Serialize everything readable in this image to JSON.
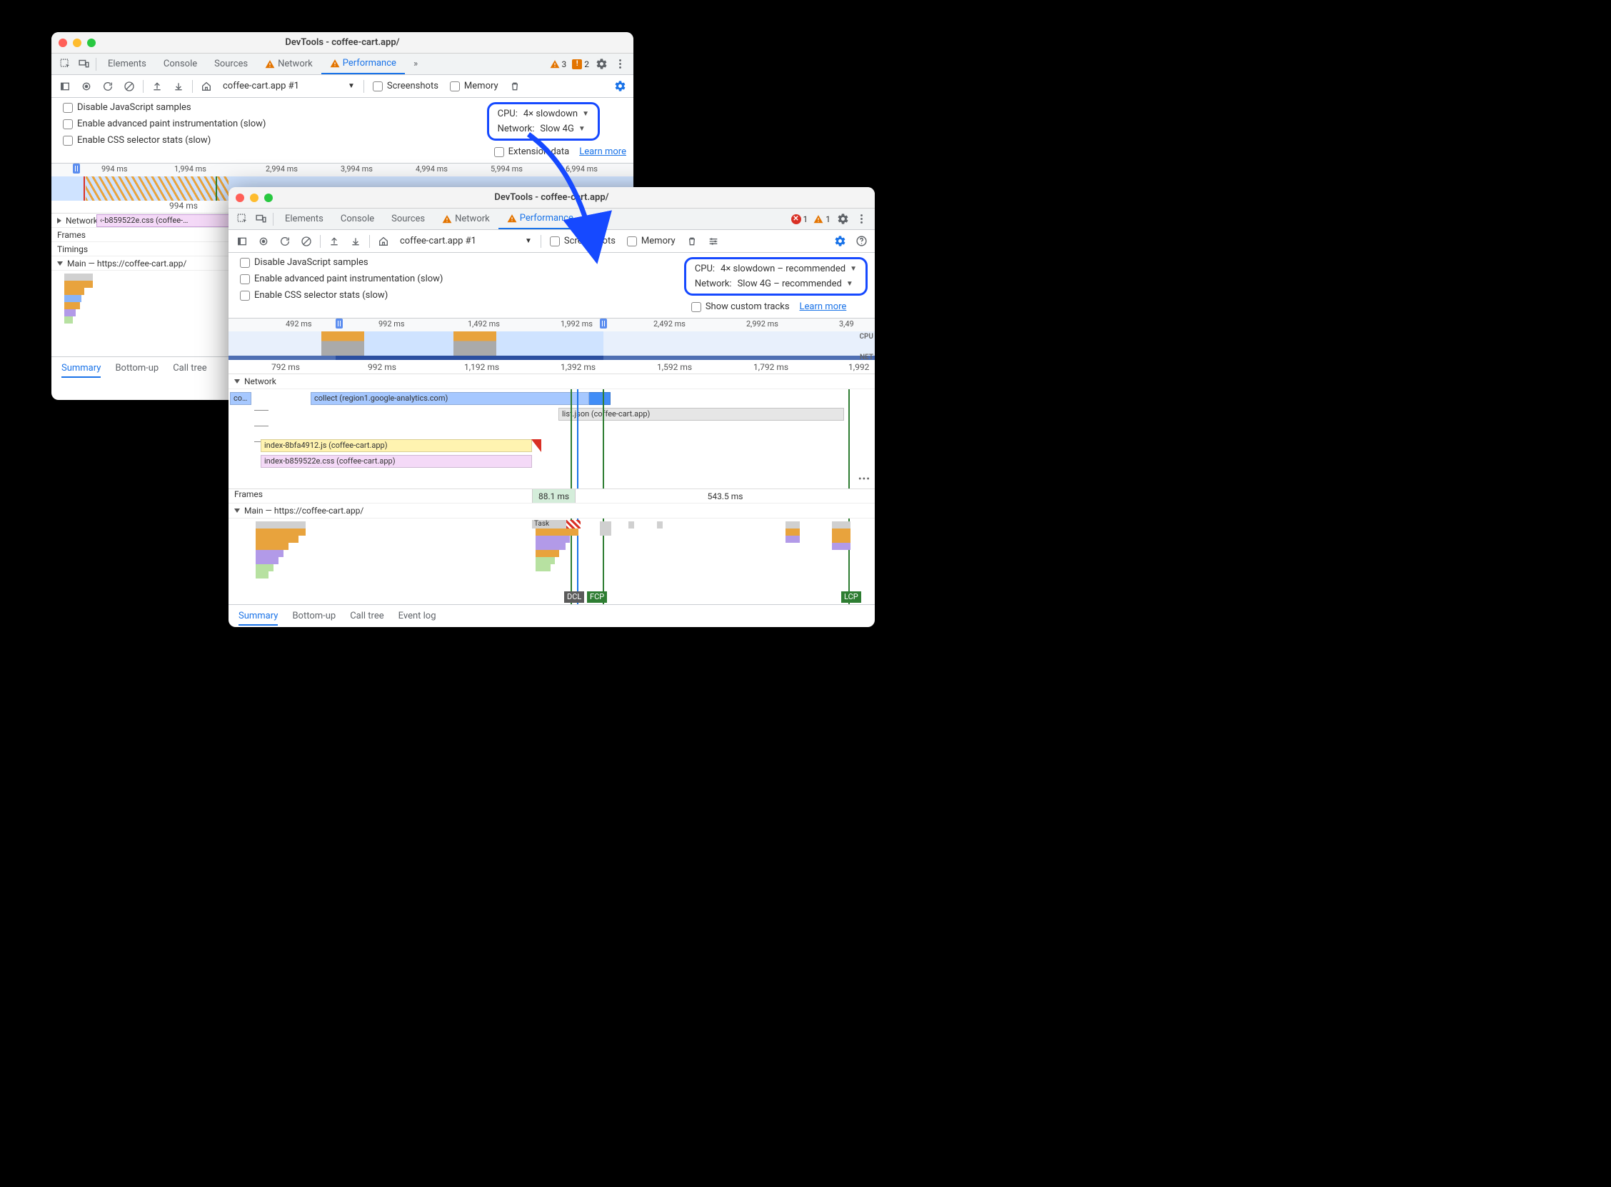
{
  "windowA": {
    "title": "DevTools - coffee-cart.app/",
    "tabs": {
      "elements": "Elements",
      "console": "Console",
      "sources": "Sources",
      "network": "Network",
      "performance": "Performance",
      "more": "»"
    },
    "warn_count": "3",
    "issue_count": "2",
    "toolbar": {
      "recording_label": "coffee-cart.app #1",
      "screenshots": "Screenshots",
      "memory": "Memory"
    },
    "settings": {
      "disable_js": "Disable JavaScript samples",
      "adv_paint": "Enable advanced paint instrumentation (slow)",
      "css_stats": "Enable CSS selector stats (slow)",
      "cpu_label": "CPU:",
      "cpu_value": "4× slowdown",
      "net_label": "Network:",
      "net_value": "Slow 4G",
      "ext_data": "Extension data",
      "learn_more": "Learn more"
    },
    "timeline_ticks": [
      "994 ms",
      "1,994 ms",
      "2,994 ms",
      "3,994 ms",
      "4,994 ms",
      "5,994 ms",
      "6,994 ms"
    ],
    "ruler2": "994 ms",
    "tracks": {
      "network": "Network",
      "network_item": "‹-b859522e.css (coffee-…",
      "frames": "Frames",
      "timings": "Timings",
      "main": "Main — https://coffee-cart.app/"
    },
    "bottom_tabs": {
      "summary": "Summary",
      "bottomup": "Bottom-up",
      "calltree": "Call tree"
    }
  },
  "windowB": {
    "title": "DevTools - coffee-cart.app/",
    "tabs": {
      "elements": "Elements",
      "console": "Console",
      "sources": "Sources",
      "network": "Network",
      "performance": "Performance",
      "more": "»"
    },
    "err_count": "1",
    "warn_count": "1",
    "toolbar": {
      "recording_label": "coffee-cart.app #1",
      "screenshots": "Screenshots",
      "memory": "Memory"
    },
    "settings": {
      "disable_js": "Disable JavaScript samples",
      "adv_paint": "Enable advanced paint instrumentation (slow)",
      "css_stats": "Enable CSS selector stats (slow)",
      "cpu_label": "CPU:",
      "cpu_value": "4× slowdown – recommended",
      "net_label": "Network:",
      "net_value": "Slow 4G – recommended",
      "show_custom": "Show custom tracks",
      "learn_more": "Learn more"
    },
    "overview_ticks": [
      "492 ms",
      "992 ms",
      "1,492 ms",
      "1,992 ms",
      "2,492 ms",
      "2,992 ms",
      "3,49"
    ],
    "overview_side": {
      "cpu": "CPU",
      "net": "NET"
    },
    "ruler_ticks": [
      "792 ms",
      "992 ms",
      "1,192 ms",
      "1,392 ms",
      "1,592 ms",
      "1,792 ms",
      "1,992"
    ],
    "tracks": {
      "network": "Network",
      "net_bars": {
        "co": "co…",
        "collect": "collect (region1.google-analytics.com)",
        "list": "list.json (coffee-cart.app)",
        "indexjs": "index-8bfa4912.js (coffee-cart.app)",
        "indexcss": "index-b859522e.css (coffee-cart.app)"
      },
      "frames": "Frames",
      "frame1": "88.1 ms",
      "frame2": "543.5 ms",
      "main": "Main — https://coffee-cart.app/",
      "task": "Task",
      "markers": {
        "dcl": "DCL",
        "fcp": "FCP",
        "lcp": "LCP"
      }
    },
    "more": "•••",
    "bottom_tabs": {
      "summary": "Summary",
      "bottomup": "Bottom-up",
      "calltree": "Call tree",
      "eventlog": "Event log"
    }
  }
}
